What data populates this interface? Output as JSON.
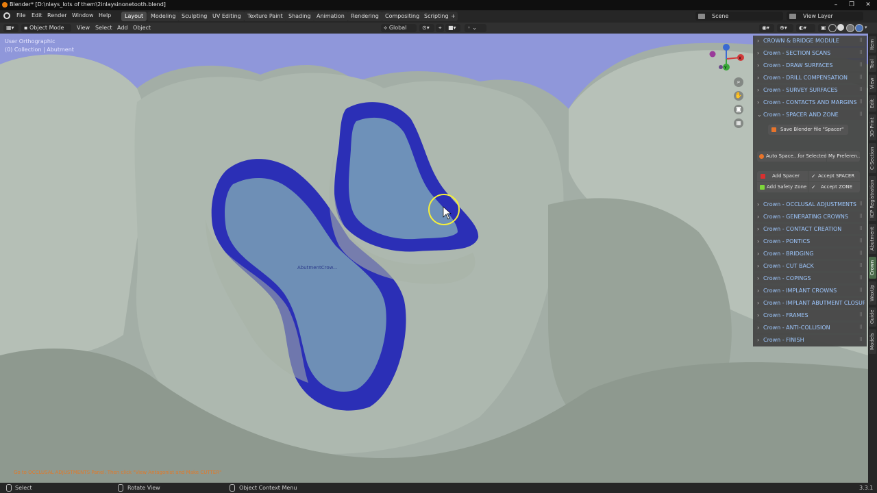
{
  "window": {
    "title": "Blender* [D:\\nlays_lots of them\\2inlaysinonetooth.blend]",
    "controls": [
      "–",
      "❐",
      "✕"
    ]
  },
  "menu": {
    "items": [
      "File",
      "Edit",
      "Render",
      "Window",
      "Help"
    ],
    "workspaces": [
      "Layout",
      "Modeling",
      "Sculpting",
      "UV Editing",
      "Texture Paint",
      "Shading",
      "Animation",
      "Rendering",
      "Compositing",
      "Scripting"
    ],
    "active_workspace": "Layout",
    "add_tab": "+",
    "scene": "Scene",
    "view_layer": "View Layer"
  },
  "header": {
    "mode": "Object Mode",
    "items": [
      "View",
      "Select",
      "Add",
      "Object"
    ],
    "transform_orientation": "Global"
  },
  "viewport": {
    "view_name": "User Orthographic",
    "collection": "(0) Collection | Abutment",
    "object_label": "AbutmentCrow...",
    "info_message": "Go to OCCLUSAL ADJUSTMENTS Panel. Then click \"View Antagonist and Make CUTTER\"",
    "background_color": "#8f97da",
    "gizmo": {
      "x": "X",
      "y": "Y",
      "z": "Z"
    }
  },
  "npanel": {
    "sections_top": [
      "CROWN & BRIDGE MODULE",
      "Crown - SECTION SCANS",
      "Crown - DRAW SURFACES",
      "Crown - DRILL COMPENSATION",
      "Crown - SURVEY SURFACES",
      "Crown - CONTACTS AND MARGINS",
      "Crown - SPACER AND ZONE"
    ],
    "save_button": "Save Blender file \"Spacer\"",
    "auto_space_button": "Auto Space...for Selected",
    "my_preferences_button": "My Preferen...",
    "add_spacer_button": "Add Spacer",
    "accept_spacer_button": "Accept SPACER",
    "add_safety_zone_button": "Add Safety Zone",
    "accept_zone_button": "Accept ZONE",
    "sections_bottom": [
      "Crown - OCCLUSAL ADJUSTMENTS",
      "Crown - GENERATING CROWNS",
      "Crown - CONTACT CREATION",
      "Crown - PONTICS",
      "Crown - BRIDGING",
      "Crown - CUT BACK",
      "Crown - COPINGS",
      "Crown - IMPLANT CROWNS",
      "Crown - IMPLANT  ABUTMENT CLOSURE",
      "Crown - FRAMES",
      "Crown - ANTI-COLLISION",
      "Crown - FINISH"
    ]
  },
  "side_tabs": [
    "Item",
    "Tool",
    "View",
    "Edit",
    "3D-Print",
    "C-Section",
    "ICP Registration",
    "Abutment",
    "Crown",
    "WaxUp",
    "Guide",
    "Models"
  ],
  "active_side_tab": "Crown",
  "status": {
    "select": "Select",
    "rotate": "Rotate View",
    "context_menu": "Object Context Menu",
    "version": "3.3.1"
  }
}
